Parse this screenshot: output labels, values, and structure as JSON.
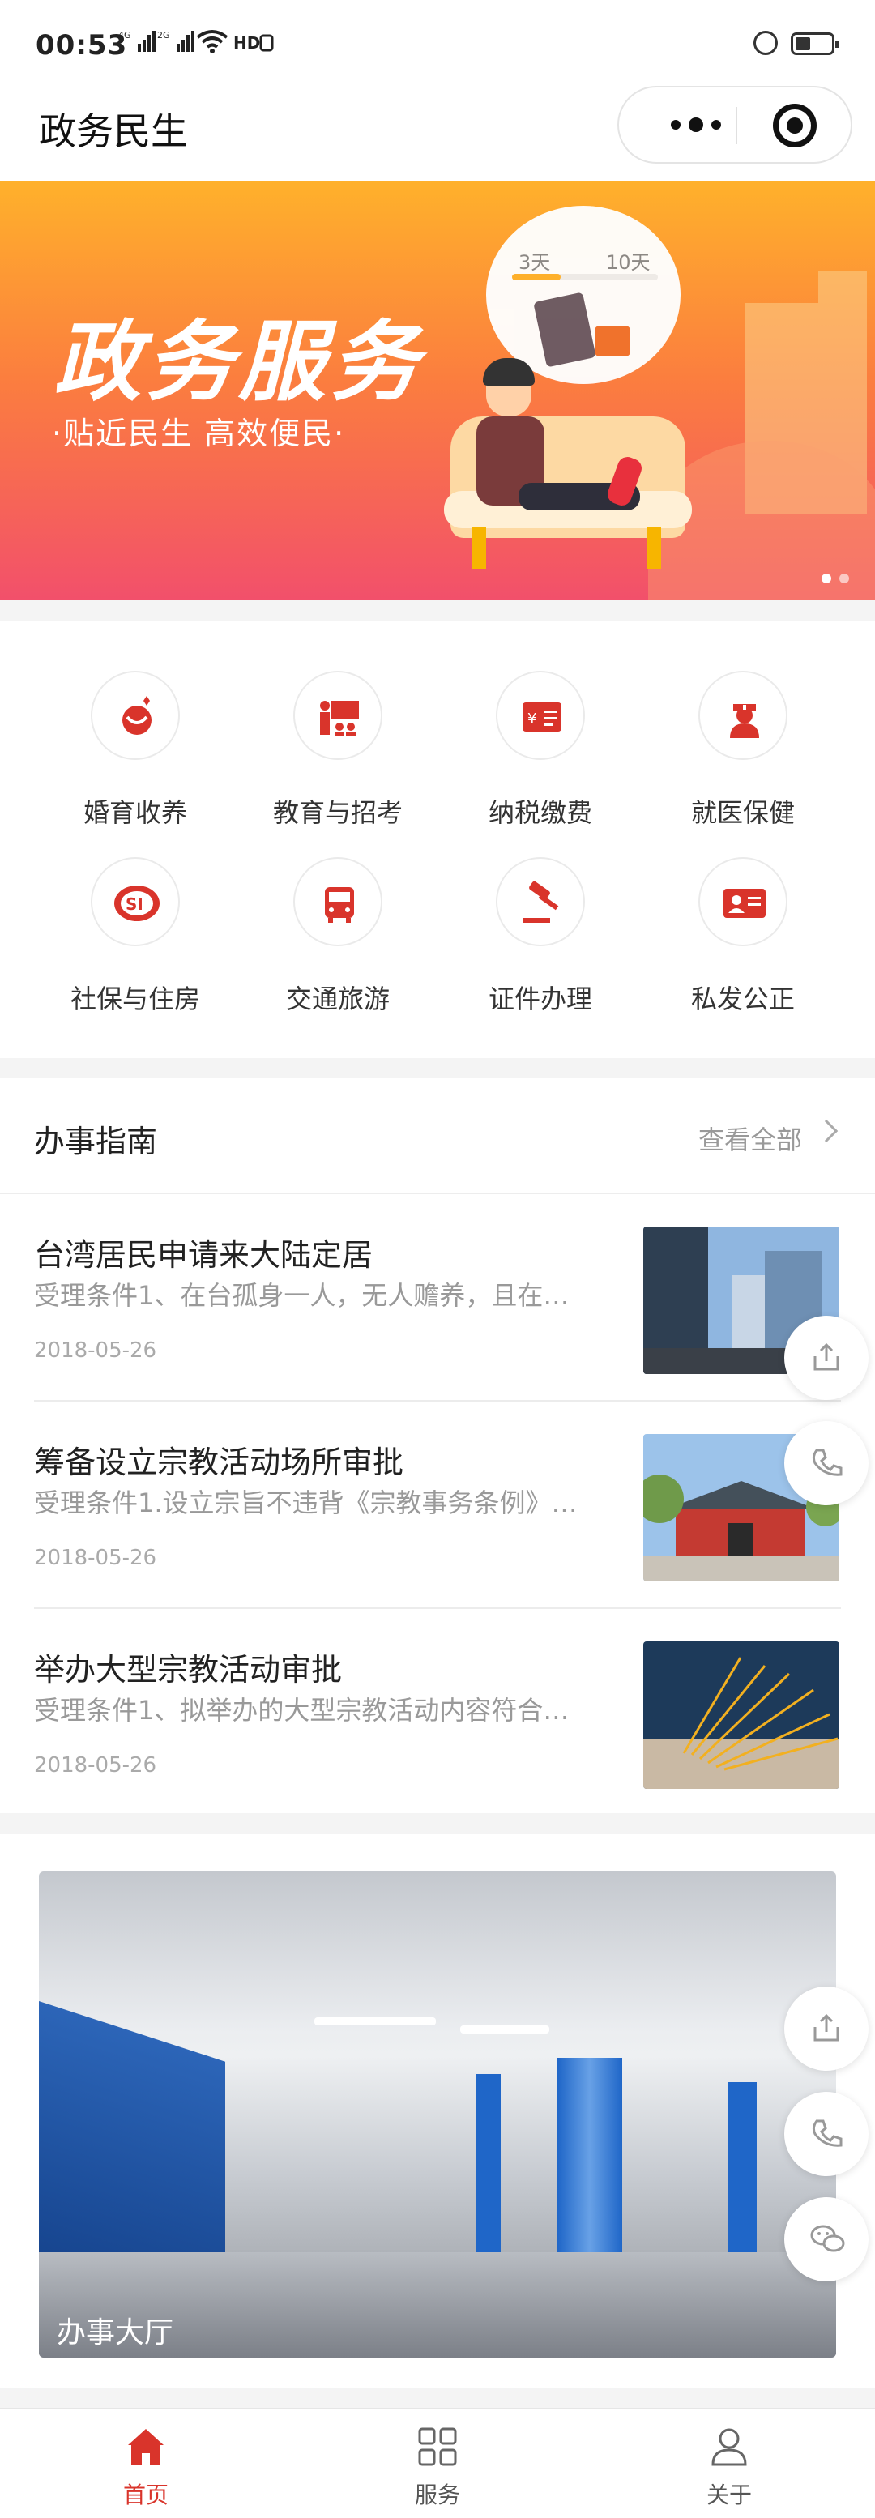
{
  "status_bar": {
    "time": "00:53",
    "signal_1": "4G",
    "signal_2": "2G",
    "hd": "HD",
    "wifi": "wifi-icon",
    "alarm": "alarm-icon",
    "battery": "battery-icon"
  },
  "navbar": {
    "title": "政务民生",
    "more_icon": "more-dots-icon",
    "close_icon": "target-close-icon"
  },
  "banner": {
    "title": "政务服务",
    "subtitle": "·贴近民生  高效便民·",
    "bubble_left": "3天",
    "bubble_right": "10天",
    "pages": 2,
    "active_page": 1,
    "colors": {
      "top": "#ffb12b",
      "bottom": "#f2506b"
    }
  },
  "categories": [
    {
      "label": "婚育收养",
      "icon": "family-icon"
    },
    {
      "label": "教育与招考",
      "icon": "teacher-icon"
    },
    {
      "label": "纳税缴费",
      "icon": "tax-icon"
    },
    {
      "label": "就医保健",
      "icon": "nurse-icon"
    },
    {
      "label": "社保与住房",
      "icon": "social-security-icon"
    },
    {
      "label": "交通旅游",
      "icon": "bus-icon"
    },
    {
      "label": "证件办理",
      "icon": "gavel-icon"
    },
    {
      "label": "私发公正",
      "icon": "id-card-icon"
    }
  ],
  "guide": {
    "title": "办事指南",
    "view_all": "查看全部",
    "items": [
      {
        "title": "台湾居民申请来大陆定居",
        "desc": "受理条件1、在台孤身一人，无人赡养，且在…",
        "date": "2018-05-26"
      },
      {
        "title": "筹备设立宗教活动场所审批",
        "desc": "受理条件1.设立宗旨不违背《宗教事务条例》…",
        "date": "2018-05-26"
      },
      {
        "title": "举办大型宗教活动审批",
        "desc": "受理条件1、拟举办的大型宗教活动内容符合…",
        "date": "2018-05-26"
      }
    ]
  },
  "hall": {
    "label": "办事大厅"
  },
  "tabs": [
    {
      "label": "首页",
      "icon": "home-icon",
      "active": true
    },
    {
      "label": "服务",
      "icon": "grid-icon",
      "active": false
    },
    {
      "label": "关于",
      "icon": "person-icon",
      "active": false
    }
  ],
  "accent_color": "#d9342b"
}
